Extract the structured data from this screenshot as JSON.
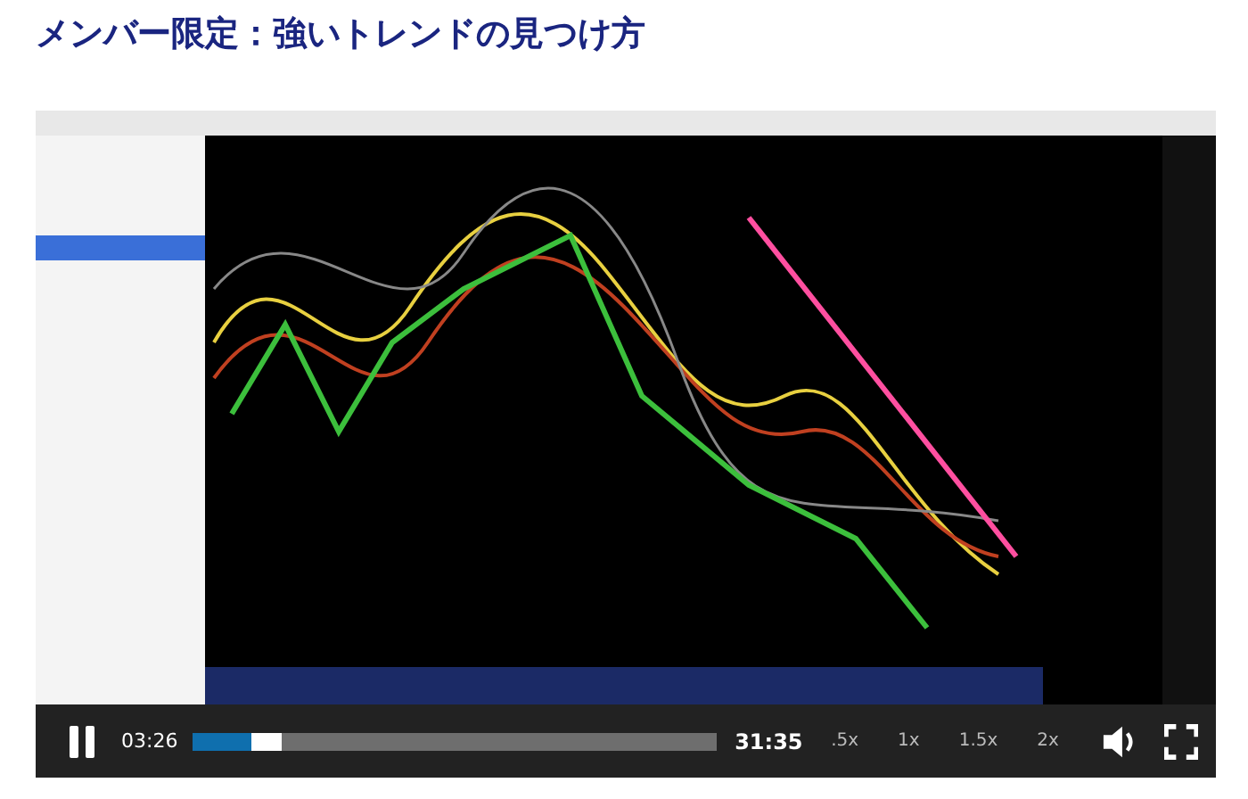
{
  "title": "メンバー限定：強いトレンドの見つけ方",
  "player": {
    "playing": true,
    "current_time": "03:26",
    "duration": "31:35",
    "played": {
      "level": 0.11
    },
    "buffered": {
      "level": 0.17
    },
    "speeds": [
      {
        "label": ".5x"
      },
      {
        "label": "1x"
      },
      {
        "label": "1.5x"
      },
      {
        "label": "2x"
      }
    ]
  }
}
